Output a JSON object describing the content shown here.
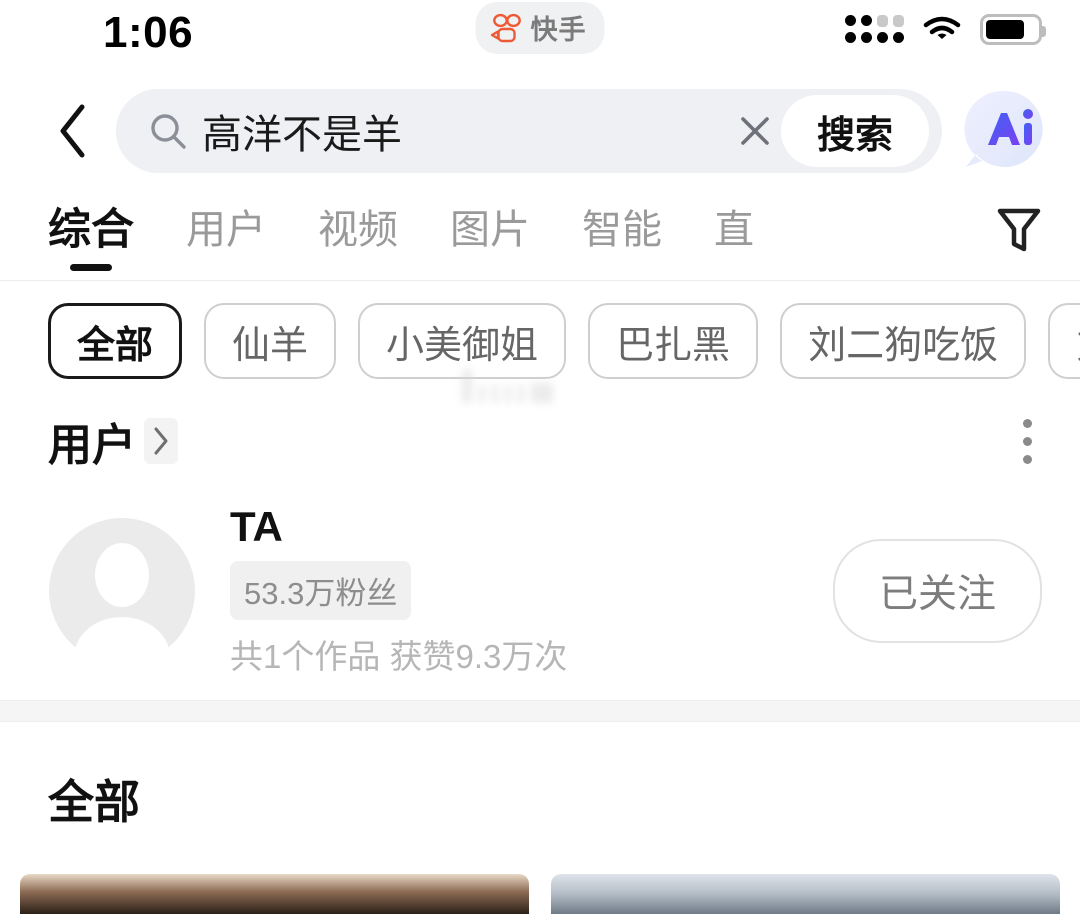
{
  "status_bar": {
    "time": "1:06",
    "app_badge_label": "快手",
    "icons": {
      "signal": "signal-dots-icon",
      "wifi": "wifi-icon",
      "battery": "battery-icon"
    },
    "battery_level_pct": 75
  },
  "search": {
    "back_icon": "back-chevron-icon",
    "search_icon": "search-icon",
    "query": "高洋不是羊",
    "placeholder": "搜索",
    "clear_icon": "close-x-icon",
    "submit_label": "搜索",
    "ai_button_label": "Ai",
    "field_bg": "#eef0f4"
  },
  "tabs": {
    "items": [
      {
        "label": "综合",
        "active": true
      },
      {
        "label": "用户",
        "active": false
      },
      {
        "label": "视频",
        "active": false
      },
      {
        "label": "图片",
        "active": false
      },
      {
        "label": "智能",
        "active": false
      },
      {
        "label": "直",
        "active": false
      }
    ],
    "filter_icon": "filter-funnel-icon",
    "active_color": "#111111",
    "inactive_color": "#9a9a9a"
  },
  "chips": {
    "items": [
      {
        "label": "全部",
        "active": true
      },
      {
        "label": "仙羊",
        "active": false
      },
      {
        "label": "小美御姐",
        "active": false
      },
      {
        "label": "巴扎黑",
        "active": false
      },
      {
        "label": "刘二狗吃饭",
        "active": false
      },
      {
        "label": "方丈",
        "active": false
      }
    ]
  },
  "user_section": {
    "title": "用户",
    "arrow_icon": "chevron-right-icon",
    "more_icon": "kebab-menu-icon",
    "user": {
      "avatar_icon": "default-avatar-icon",
      "name": "TA",
      "followers_badge": "53.3万粉丝",
      "stats": "共1个作品 获赞9.3万次",
      "follow_button_label": "已关注"
    }
  },
  "all_section": {
    "title": "全部"
  }
}
